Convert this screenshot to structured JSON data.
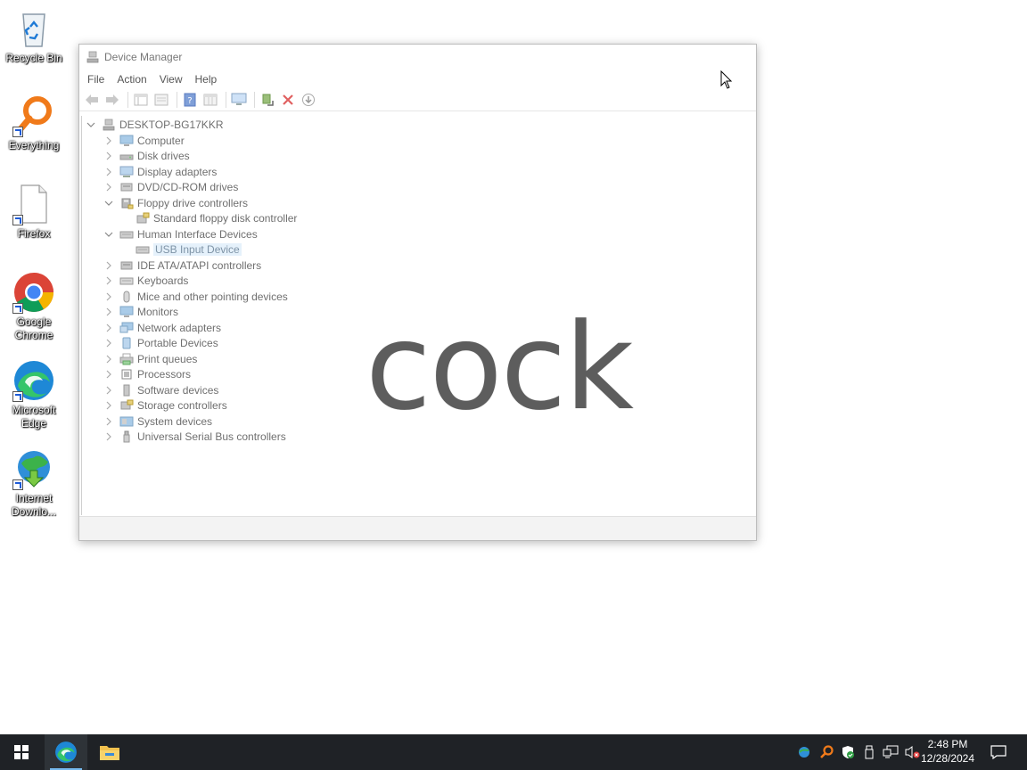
{
  "desktop": {
    "icons": [
      {
        "label": "Recycle Bin",
        "icon": "recycle-bin-icon"
      },
      {
        "label": "Everything",
        "icon": "magnifier-icon"
      },
      {
        "label": "Firefox",
        "icon": "blank-file-icon"
      },
      {
        "label": "Google Chrome",
        "icon": "chrome-icon"
      },
      {
        "label": "Microsoft Edge",
        "icon": "edge-icon"
      },
      {
        "label": "Internet Downlo...",
        "icon": "globe-download-icon"
      }
    ]
  },
  "window": {
    "title": "Device Manager",
    "menu": [
      "File",
      "Action",
      "View",
      "Help"
    ],
    "toolbar_icons": [
      "back-arrow-icon",
      "forward-arrow-icon",
      "properties-panel-icon",
      "list-view-icon",
      "help-icon",
      "details-view-icon",
      "monitor-icon",
      "update-driver-icon",
      "uninstall-x-icon",
      "download-icon"
    ],
    "tree": {
      "root": "DESKTOP-BG17KKR",
      "nodes": [
        {
          "label": "Computer",
          "expanded": false,
          "icon": "computer-icon"
        },
        {
          "label": "Disk drives",
          "expanded": false,
          "icon": "disk-icon"
        },
        {
          "label": "Display adapters",
          "expanded": false,
          "icon": "display-icon"
        },
        {
          "label": "DVD/CD-ROM drives",
          "expanded": false,
          "icon": "dvd-icon"
        },
        {
          "label": "Floppy drive controllers",
          "expanded": true,
          "icon": "floppy-controller-icon",
          "children": [
            {
              "label": "Standard floppy disk controller",
              "icon": "controller-icon"
            }
          ]
        },
        {
          "label": "Human Interface Devices",
          "expanded": true,
          "icon": "hid-icon",
          "children": [
            {
              "label": "USB Input Device",
              "icon": "usb-input-icon",
              "selected": true
            }
          ]
        },
        {
          "label": "IDE ATA/ATAPI controllers",
          "expanded": false,
          "icon": "ide-icon"
        },
        {
          "label": "Keyboards",
          "expanded": false,
          "icon": "keyboard-icon"
        },
        {
          "label": "Mice and other pointing devices",
          "expanded": false,
          "icon": "mouse-icon"
        },
        {
          "label": "Monitors",
          "expanded": false,
          "icon": "monitor-icon"
        },
        {
          "label": "Network adapters",
          "expanded": false,
          "icon": "network-icon"
        },
        {
          "label": "Portable Devices",
          "expanded": false,
          "icon": "portable-icon"
        },
        {
          "label": "Print queues",
          "expanded": false,
          "icon": "printer-icon"
        },
        {
          "label": "Processors",
          "expanded": false,
          "icon": "processor-icon"
        },
        {
          "label": "Software devices",
          "expanded": false,
          "icon": "software-icon"
        },
        {
          "label": "Storage controllers",
          "expanded": false,
          "icon": "storage-icon"
        },
        {
          "label": "System devices",
          "expanded": false,
          "icon": "system-icon"
        },
        {
          "label": "Universal Serial Bus controllers",
          "expanded": false,
          "icon": "usb-icon"
        }
      ]
    }
  },
  "overlay": {
    "text": "cock"
  },
  "taskbar": {
    "apps": [
      "start-icon",
      "edge-icon",
      "file-explorer-icon"
    ],
    "tray_icons": [
      "app-tray-icon",
      "search-tray-icon",
      "security-shield-icon",
      "usb-tray-icon",
      "network-icon",
      "volume-muted-icon"
    ],
    "time": "2:48 PM",
    "date": "12/28/2024"
  },
  "colors": {
    "accent": "#1e5bd6",
    "taskbar": "#1f2226",
    "selection": "#e5f1fb"
  }
}
